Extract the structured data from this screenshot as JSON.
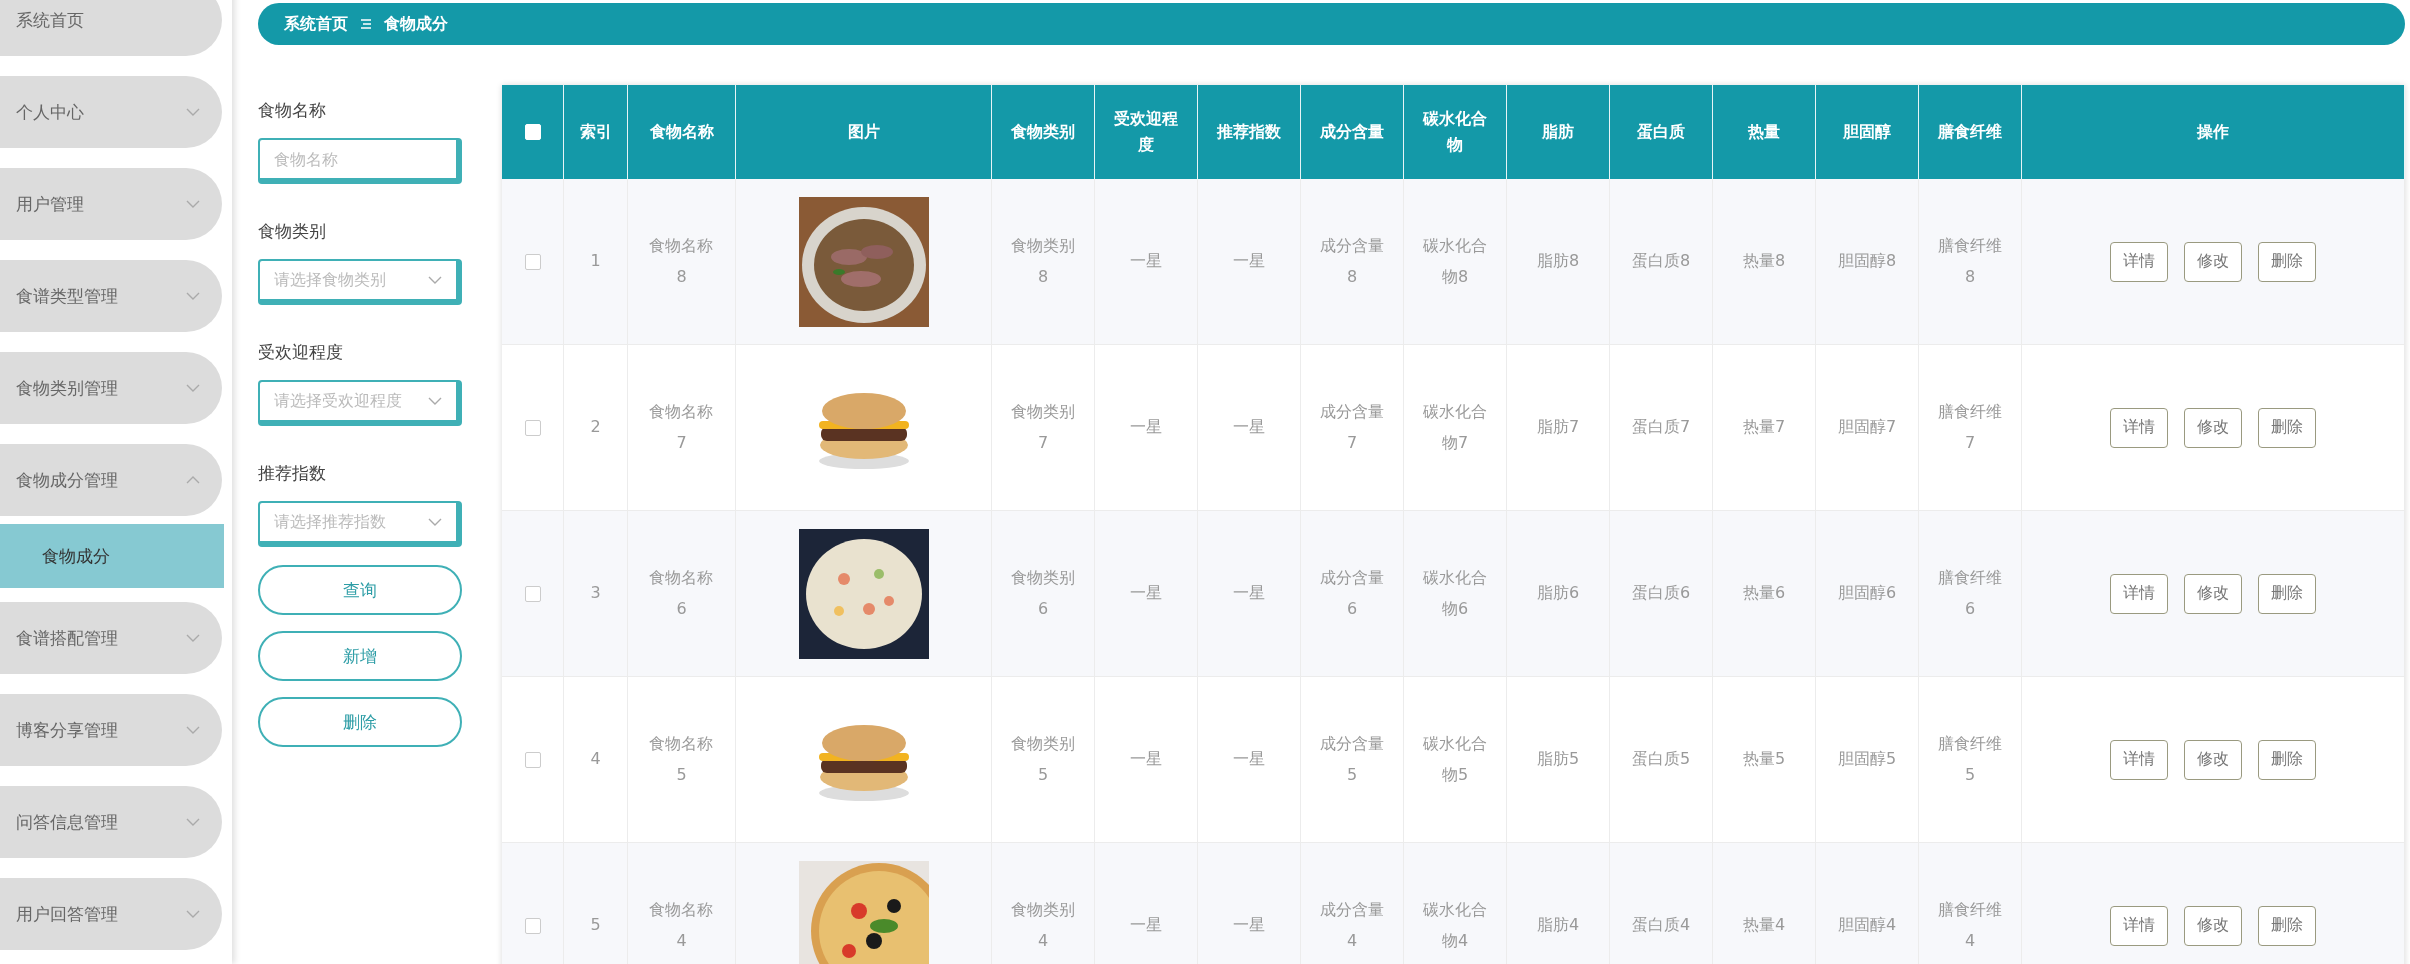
{
  "sidebar": {
    "items": [
      {
        "label": "系统首页",
        "kind": "link"
      },
      {
        "label": "个人中心",
        "kind": "menu",
        "expanded": false
      },
      {
        "label": "用户管理",
        "kind": "menu",
        "expanded": false
      },
      {
        "label": "食谱类型管理",
        "kind": "menu",
        "expanded": false
      },
      {
        "label": "食物类别管理",
        "kind": "menu",
        "expanded": false
      },
      {
        "label": "食物成分管理",
        "kind": "menu",
        "expanded": true,
        "children": [
          {
            "label": "食物成分",
            "selected": true
          }
        ]
      },
      {
        "label": "食谱搭配管理",
        "kind": "menu",
        "expanded": false
      },
      {
        "label": "博客分享管理",
        "kind": "menu",
        "expanded": false
      },
      {
        "label": "问答信息管理",
        "kind": "menu",
        "expanded": false
      },
      {
        "label": "用户回答管理",
        "kind": "menu",
        "expanded": false
      }
    ]
  },
  "breadcrumb": {
    "home": "系统首页",
    "current": "食物成分"
  },
  "filters": [
    {
      "label": "食物名称",
      "kind": "input",
      "placeholder": "食物名称"
    },
    {
      "label": "食物类别",
      "kind": "select",
      "placeholder": "请选择食物类别"
    },
    {
      "label": "受欢迎程度",
      "kind": "select",
      "placeholder": "请选择受欢迎程度"
    },
    {
      "label": "推荐指数",
      "kind": "select",
      "placeholder": "请选择推荐指数"
    }
  ],
  "filter_buttons": [
    "查询",
    "新增",
    "删除"
  ],
  "table": {
    "select_all": {
      "checked": false
    },
    "columns": [
      "索引",
      "食物名称",
      "图片",
      "食物类别",
      "受欢迎程度",
      "推荐指数",
      "成分含量",
      "碳水化合物",
      "脂肪",
      "蛋白质",
      "热量",
      "胆固醇",
      "膳食纤维",
      "操作"
    ],
    "rows": [
      {
        "selected": false,
        "cells": [
          "1",
          "食物名称8",
          {
            "kind": "picture"
          },
          "食物类别8",
          "一星",
          "一星",
          "成分含量8",
          "碳水化合物8",
          "脂肪8",
          "蛋白质8",
          "热量8",
          "胆固醇8",
          "膳食纤维8"
        ],
        "actions": [
          "详情",
          "修改",
          "删除"
        ]
      },
      {
        "selected": false,
        "cells": [
          "2",
          "食物名称7",
          {
            "kind": "picture"
          },
          "食物类别7",
          "一星",
          "一星",
          "成分含量7",
          "碳水化合物7",
          "脂肪7",
          "蛋白质7",
          "热量7",
          "胆固醇7",
          "膳食纤维7"
        ],
        "actions": [
          "详情",
          "修改",
          "删除"
        ]
      },
      {
        "selected": false,
        "cells": [
          "3",
          "食物名称6",
          {
            "kind": "picture"
          },
          "食物类别6",
          "一星",
          "一星",
          "成分含量6",
          "碳水化合物6",
          "脂肪6",
          "蛋白质6",
          "热量6",
          "胆固醇6",
          "膳食纤维6"
        ],
        "actions": [
          "详情",
          "修改",
          "删除"
        ]
      },
      {
        "selected": false,
        "cells": [
          "4",
          "食物名称5",
          {
            "kind": "picture"
          },
          "食物类别5",
          "一星",
          "一星",
          "成分含量5",
          "碳水化合物5",
          "脂肪5",
          "蛋白质5",
          "热量5",
          "胆固醇5",
          "膳食纤维5"
        ],
        "actions": [
          "详情",
          "修改",
          "删除"
        ]
      },
      {
        "selected": false,
        "cells": [
          "5",
          "食物名称4",
          {
            "kind": "picture"
          },
          "食物类别4",
          "一星",
          "一星",
          "成分含量4",
          "碳水化合物4",
          "脂肪4",
          "蛋白质4",
          "热量4",
          "胆固醇4",
          "膳食纤维4"
        ],
        "actions": [
          "详情",
          "修改",
          "删除"
        ]
      }
    ]
  }
}
